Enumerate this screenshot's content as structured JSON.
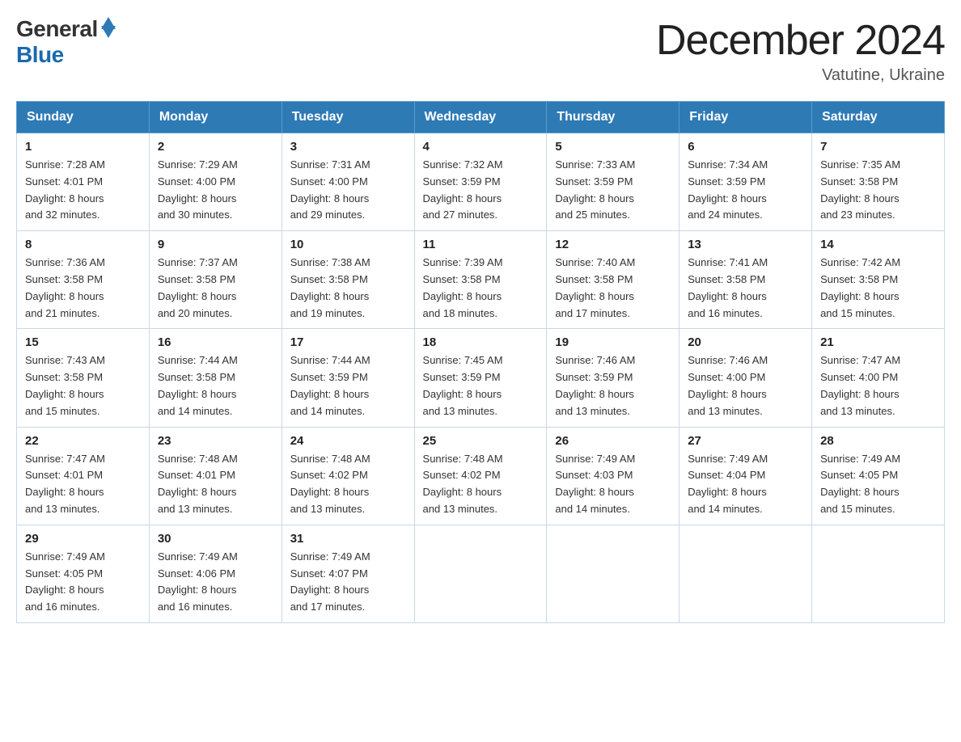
{
  "logo": {
    "general_text": "General",
    "blue_text": "Blue"
  },
  "title": {
    "month_year": "December 2024",
    "location": "Vatutine, Ukraine"
  },
  "weekdays": [
    "Sunday",
    "Monday",
    "Tuesday",
    "Wednesday",
    "Thursday",
    "Friday",
    "Saturday"
  ],
  "weeks": [
    [
      {
        "day": "1",
        "sunrise": "7:28 AM",
        "sunset": "4:01 PM",
        "daylight": "8 hours and 32 minutes."
      },
      {
        "day": "2",
        "sunrise": "7:29 AM",
        "sunset": "4:00 PM",
        "daylight": "8 hours and 30 minutes."
      },
      {
        "day": "3",
        "sunrise": "7:31 AM",
        "sunset": "4:00 PM",
        "daylight": "8 hours and 29 minutes."
      },
      {
        "day": "4",
        "sunrise": "7:32 AM",
        "sunset": "3:59 PM",
        "daylight": "8 hours and 27 minutes."
      },
      {
        "day": "5",
        "sunrise": "7:33 AM",
        "sunset": "3:59 PM",
        "daylight": "8 hours and 25 minutes."
      },
      {
        "day": "6",
        "sunrise": "7:34 AM",
        "sunset": "3:59 PM",
        "daylight": "8 hours and 24 minutes."
      },
      {
        "day": "7",
        "sunrise": "7:35 AM",
        "sunset": "3:58 PM",
        "daylight": "8 hours and 23 minutes."
      }
    ],
    [
      {
        "day": "8",
        "sunrise": "7:36 AM",
        "sunset": "3:58 PM",
        "daylight": "8 hours and 21 minutes."
      },
      {
        "day": "9",
        "sunrise": "7:37 AM",
        "sunset": "3:58 PM",
        "daylight": "8 hours and 20 minutes."
      },
      {
        "day": "10",
        "sunrise": "7:38 AM",
        "sunset": "3:58 PM",
        "daylight": "8 hours and 19 minutes."
      },
      {
        "day": "11",
        "sunrise": "7:39 AM",
        "sunset": "3:58 PM",
        "daylight": "8 hours and 18 minutes."
      },
      {
        "day": "12",
        "sunrise": "7:40 AM",
        "sunset": "3:58 PM",
        "daylight": "8 hours and 17 minutes."
      },
      {
        "day": "13",
        "sunrise": "7:41 AM",
        "sunset": "3:58 PM",
        "daylight": "8 hours and 16 minutes."
      },
      {
        "day": "14",
        "sunrise": "7:42 AM",
        "sunset": "3:58 PM",
        "daylight": "8 hours and 15 minutes."
      }
    ],
    [
      {
        "day": "15",
        "sunrise": "7:43 AM",
        "sunset": "3:58 PM",
        "daylight": "8 hours and 15 minutes."
      },
      {
        "day": "16",
        "sunrise": "7:44 AM",
        "sunset": "3:58 PM",
        "daylight": "8 hours and 14 minutes."
      },
      {
        "day": "17",
        "sunrise": "7:44 AM",
        "sunset": "3:59 PM",
        "daylight": "8 hours and 14 minutes."
      },
      {
        "day": "18",
        "sunrise": "7:45 AM",
        "sunset": "3:59 PM",
        "daylight": "8 hours and 13 minutes."
      },
      {
        "day": "19",
        "sunrise": "7:46 AM",
        "sunset": "3:59 PM",
        "daylight": "8 hours and 13 minutes."
      },
      {
        "day": "20",
        "sunrise": "7:46 AM",
        "sunset": "4:00 PM",
        "daylight": "8 hours and 13 minutes."
      },
      {
        "day": "21",
        "sunrise": "7:47 AM",
        "sunset": "4:00 PM",
        "daylight": "8 hours and 13 minutes."
      }
    ],
    [
      {
        "day": "22",
        "sunrise": "7:47 AM",
        "sunset": "4:01 PM",
        "daylight": "8 hours and 13 minutes."
      },
      {
        "day": "23",
        "sunrise": "7:48 AM",
        "sunset": "4:01 PM",
        "daylight": "8 hours and 13 minutes."
      },
      {
        "day": "24",
        "sunrise": "7:48 AM",
        "sunset": "4:02 PM",
        "daylight": "8 hours and 13 minutes."
      },
      {
        "day": "25",
        "sunrise": "7:48 AM",
        "sunset": "4:02 PM",
        "daylight": "8 hours and 13 minutes."
      },
      {
        "day": "26",
        "sunrise": "7:49 AM",
        "sunset": "4:03 PM",
        "daylight": "8 hours and 14 minutes."
      },
      {
        "day": "27",
        "sunrise": "7:49 AM",
        "sunset": "4:04 PM",
        "daylight": "8 hours and 14 minutes."
      },
      {
        "day": "28",
        "sunrise": "7:49 AM",
        "sunset": "4:05 PM",
        "daylight": "8 hours and 15 minutes."
      }
    ],
    [
      {
        "day": "29",
        "sunrise": "7:49 AM",
        "sunset": "4:05 PM",
        "daylight": "8 hours and 16 minutes."
      },
      {
        "day": "30",
        "sunrise": "7:49 AM",
        "sunset": "4:06 PM",
        "daylight": "8 hours and 16 minutes."
      },
      {
        "day": "31",
        "sunrise": "7:49 AM",
        "sunset": "4:07 PM",
        "daylight": "8 hours and 17 minutes."
      },
      null,
      null,
      null,
      null
    ]
  ],
  "labels": {
    "sunrise_prefix": "Sunrise: ",
    "sunset_prefix": "Sunset: ",
    "daylight_prefix": "Daylight: "
  }
}
